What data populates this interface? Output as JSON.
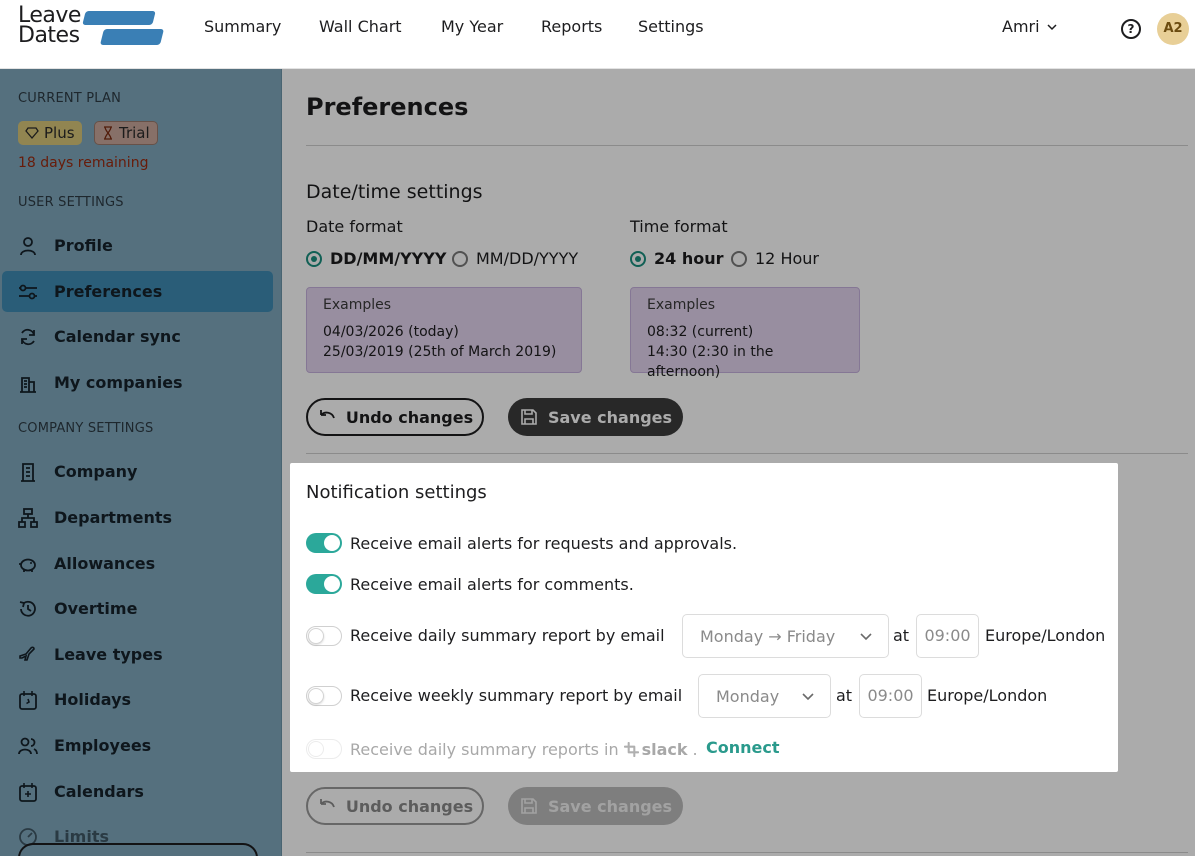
{
  "app": {
    "logo_line1": "Leave",
    "logo_line2": "Dates"
  },
  "nav": {
    "items": [
      "Summary",
      "Wall Chart",
      "My Year",
      "Reports",
      "Settings"
    ],
    "user_name": "Amri",
    "avatar_initials": "A2"
  },
  "sidebar": {
    "plan_title": "CURRENT PLAN",
    "plan_badge": "Plus",
    "trial_badge": "Trial",
    "days_remaining": "18 days remaining",
    "user_settings_title": "USER SETTINGS",
    "user_items": [
      "Profile",
      "Preferences",
      "Calendar sync",
      "My companies"
    ],
    "company_settings_title": "COMPANY SETTINGS",
    "company_items": [
      "Company",
      "Departments",
      "Allowances",
      "Overtime",
      "Leave types",
      "Holidays",
      "Employees",
      "Calendars",
      "Limits"
    ]
  },
  "main": {
    "title": "Preferences",
    "datetime": {
      "heading": "Date/time settings",
      "date_format_label": "Date format",
      "date_options": [
        "DD/MM/YYYY",
        "MM/DD/YYYY"
      ],
      "time_format_label": "Time format",
      "time_options": [
        "24 hour",
        "12 Hour"
      ],
      "date_examples_title": "Examples",
      "date_example_1": "04/03/2026 (today)",
      "date_example_2": "25/03/2019 (25th of March 2019)",
      "time_examples_title": "Examples",
      "time_example_1": "08:32 (current)",
      "time_example_2": "14:30 (2:30 in the afternoon)"
    },
    "buttons": {
      "undo": "Undo changes",
      "save": "Save changes"
    },
    "notifications": {
      "heading": "Notification settings",
      "email_requests": "Receive email alerts for requests and approvals.",
      "email_comments": "Receive email alerts for comments.",
      "daily_report": "Receive daily summary report by email",
      "daily_days": "Monday → Friday",
      "at": "at",
      "daily_time": "09:00",
      "timezone": "Europe/London",
      "weekly_report": "Receive weekly summary report by email",
      "weekly_day": "Monday",
      "weekly_time": "09:00",
      "slack_text": "Receive daily summary reports in",
      "slack_brand": "slack",
      "slack_suffix": ".",
      "connect": "Connect"
    }
  },
  "colors": {
    "accent_teal": "#2ba89a",
    "sidebar_bg": "#7fa8bd",
    "active_item": "#3f8bb3",
    "trial_warning": "#9a2a10"
  }
}
